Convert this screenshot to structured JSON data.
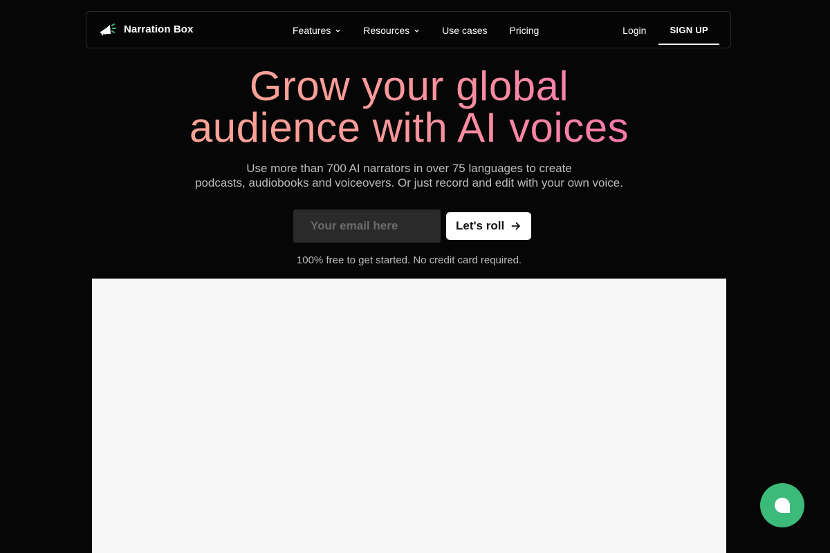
{
  "brand": {
    "name": "Narration Box",
    "icon": "megaphone-icon"
  },
  "nav": {
    "items": [
      {
        "label": "Features",
        "has_dropdown": true
      },
      {
        "label": "Resources",
        "has_dropdown": true
      },
      {
        "label": "Use cases",
        "has_dropdown": false
      },
      {
        "label": "Pricing",
        "has_dropdown": false
      }
    ],
    "login_label": "Login",
    "signup_label": "SIGN UP"
  },
  "hero": {
    "title_line1": "Grow your global",
    "title_line2": "audience with AI voices",
    "subtitle_line1": "Use more than 700 AI narrators in over 75 languages to create",
    "subtitle_line2": "podcasts, audiobooks and voiceovers. Or just record and edit with your own voice.",
    "email_placeholder": "Your email here",
    "email_value": "",
    "cta_label": "Let's roll",
    "note": "100% free to get started. No credit card required."
  },
  "chat": {
    "icon": "chat-bubble-icon",
    "color": "#3cba79"
  },
  "colors": {
    "background": "#060606",
    "gradient_start": "#fcb08e",
    "gradient_end": "#f45fb8",
    "preview_bg": "#f7f7f7"
  }
}
